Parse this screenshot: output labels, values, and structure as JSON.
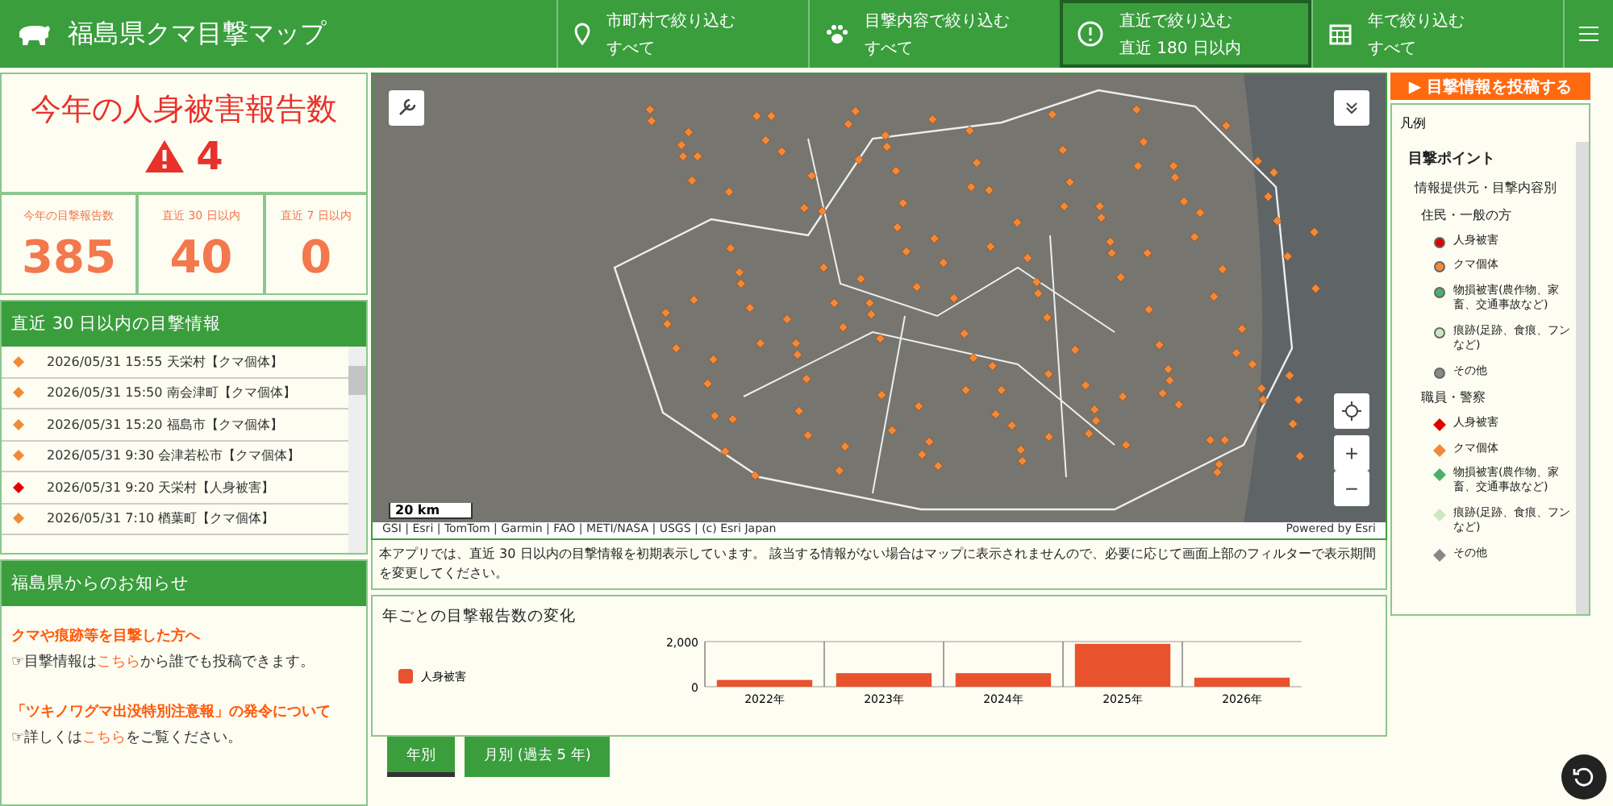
{
  "header": {
    "title": "福島県クマ目撃マップ",
    "filters": [
      {
        "kind": "pin",
        "label": "市町村で絞り込む",
        "value": "すべて",
        "selected": false
      },
      {
        "kind": "paw",
        "label": "目撃内容で絞り込む",
        "value": "すべて",
        "selected": false
      },
      {
        "kind": "alert",
        "label": "直近で絞り込む",
        "value": "直近 180 日以内",
        "selected": true
      },
      {
        "kind": "calendar",
        "label": "年で絞り込む",
        "value": "すべて",
        "selected": false
      }
    ]
  },
  "injury_panel": {
    "title": "今年の人身被害報告数",
    "count": "4"
  },
  "stats": [
    {
      "label": "今年の目撃報告数",
      "value": "385"
    },
    {
      "label": "直近 30 日以内",
      "value": "40"
    },
    {
      "label": "直近 7 日以内",
      "value": "0"
    }
  ],
  "recent": {
    "title": "直近 30 日以内の目撃情報",
    "items": [
      {
        "text": "2026/05/31 15:55 天栄村【クマ個体】",
        "color": "#f08a3a"
      },
      {
        "text": "2026/05/31 15:50 南会津町【クマ個体】",
        "color": "#f08a3a"
      },
      {
        "text": "2026/05/31 15:20 福島市【クマ個体】",
        "color": "#f08a3a"
      },
      {
        "text": "2026/05/31 9:30 会津若松市【クマ個体】",
        "color": "#f08a3a"
      },
      {
        "text": "2026/05/31 9:20 天栄村【人身被害】",
        "color": "#e00000"
      },
      {
        "text": "2026/05/31 7:10 楢葉町【クマ個体】",
        "color": "#f08a3a"
      }
    ]
  },
  "notices": {
    "title": "福島県からのお知らせ",
    "items": [
      {
        "heading": "クマや痕跡等を目撃した方へ",
        "before": "☞目撃情報は",
        "link": "こちら",
        "after": "から誰でも投稿できます。"
      },
      {
        "heading": "「ツキノワグマ出没特別注意報」の発令について",
        "before": "☞詳しくは",
        "link": "こちら",
        "after": "をご覧ください。"
      }
    ]
  },
  "map": {
    "scale": "20 km",
    "attribution": "GSI | Esri | TomTom | Garmin | FAO | METI/NASA | USGS | (c) Esri Japan",
    "powered": "Powered by Esri",
    "zoom_in": "+",
    "zoom_out": "−"
  },
  "info": "本アプリでは、直近 30 日以内の目撃情報を初期表示しています。 該当する情報がない場合はマップに表示されませんので、必要に応じて画面上部のフィルターで表示期間を変更してください。",
  "chart_panel": {
    "title": "年ごとの目撃報告数の変化",
    "chart_data": {
      "type": "bar",
      "categories": [
        "2022年",
        "2023年",
        "2024年",
        "2025年",
        "2026年"
      ],
      "series": [
        {
          "name": "人身被害",
          "color": "#e8522c",
          "values": [
            300,
            600,
            600,
            1900,
            400
          ]
        }
      ],
      "ylim": [
        0,
        2000
      ],
      "yticks": [
        {
          "value": 0,
          "label": "0"
        },
        {
          "value": 2000,
          "label": "2,000"
        }
      ]
    }
  },
  "chart_tabs": [
    {
      "label": "年別",
      "selected": true
    },
    {
      "label": "月別 (過去 5 年)",
      "selected": false
    }
  ],
  "post_button": "▶ 目撃情報を投稿する",
  "legend": {
    "title": "凡例",
    "heading": "目撃ポイント",
    "subheading": "情報提供元・目撃内容別",
    "groups": [
      {
        "name": "住民・一般の方",
        "kind": "circle",
        "items": [
          {
            "label": "人身被害",
            "color": "#e00000"
          },
          {
            "label": "クマ個体",
            "color": "#f08a3a"
          },
          {
            "label": "物損被害(農作物、家畜、交通事故など)",
            "color": "#4caf6a"
          },
          {
            "label": "痕跡(足跡、食痕、フンなど)",
            "color": "#cde8c0"
          },
          {
            "label": "その他",
            "color": "#888888"
          }
        ]
      },
      {
        "name": "職員・警察",
        "kind": "diamond",
        "items": [
          {
            "label": "人身被害",
            "color": "#e00000"
          },
          {
            "label": "クマ個体",
            "color": "#f08a3a"
          },
          {
            "label": "物損被害(農作物、家畜、交通事故など)",
            "color": "#4caf6a"
          },
          {
            "label": "痕跡(足跡、食痕、フンなど)",
            "color": "#cde8c0"
          },
          {
            "label": "その他",
            "color": "#888888"
          }
        ]
      }
    ]
  }
}
